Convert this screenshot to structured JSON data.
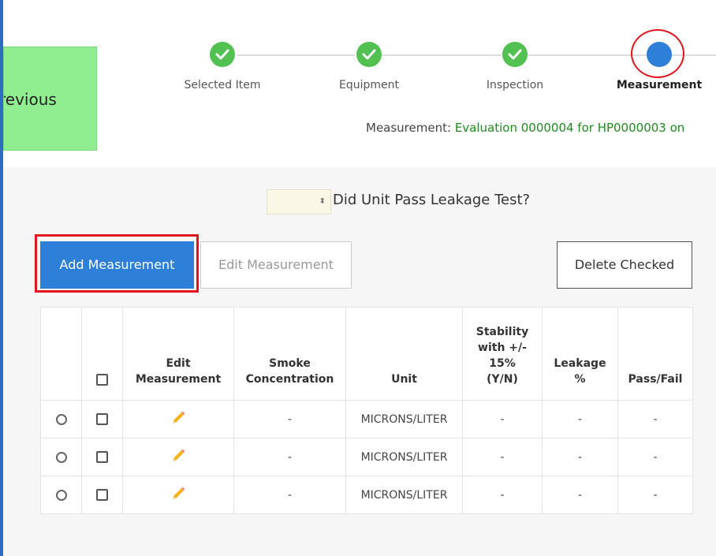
{
  "nav": {
    "previous_label": "revious"
  },
  "steps": [
    {
      "label": "Selected Item",
      "state": "done"
    },
    {
      "label": "Equipment",
      "state": "done"
    },
    {
      "label": "Inspection",
      "state": "done"
    },
    {
      "label": "Measurement",
      "state": "current"
    }
  ],
  "breadcrumb": {
    "prefix": "Measurement: ",
    "link_text": "Evaluation 0000004 for HP0000003 on"
  },
  "leakage_test": {
    "selected_value": "",
    "label": "Did Unit Pass Leakage Test?"
  },
  "toolbar": {
    "add_label": "Add Measurement",
    "edit_label": "Edit Measurement",
    "delete_label": "Delete Checked"
  },
  "table": {
    "headers": {
      "edit": "Edit Measurement",
      "smoke": "Smoke Concentration",
      "unit": "Unit",
      "stability": "Stability with +/- 15% (Y/N)",
      "leakage": "Leakage %",
      "passfail": "Pass/Fail"
    },
    "rows": [
      {
        "smoke": "-",
        "unit": "MICRONS/LITER",
        "stability": "-",
        "leakage": "-",
        "passfail": "-"
      },
      {
        "smoke": "-",
        "unit": "MICRONS/LITER",
        "stability": "-",
        "leakage": "-",
        "passfail": "-"
      },
      {
        "smoke": "-",
        "unit": "MICRONS/LITER",
        "stability": "-",
        "leakage": "-",
        "passfail": "-"
      }
    ]
  },
  "colors": {
    "done_step": "#52c152",
    "current_step": "#2d7fd8",
    "primary_button": "#2d7fd8",
    "previous_button": "#90ee90",
    "highlight": "#e0141e"
  },
  "icons": {
    "step_done": "check-icon",
    "edit_row": "pencil-icon"
  }
}
